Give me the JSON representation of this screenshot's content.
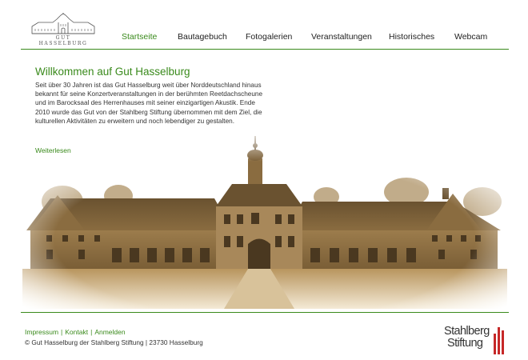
{
  "header": {
    "logo_text": "GUT HASSELBURG"
  },
  "nav": {
    "items": [
      {
        "label": "Startseite",
        "active": true
      },
      {
        "label": "Bautagebuch",
        "active": false
      },
      {
        "label": "Fotogalerien",
        "active": false
      },
      {
        "label": "Veranstaltungen",
        "active": false
      },
      {
        "label": "Historisches",
        "active": false
      },
      {
        "label": "Webcam",
        "active": false
      }
    ]
  },
  "main": {
    "title": "Willkommen auf Gut Hasselburg",
    "text": "Seit über 30 Jahren ist das Gut Hasselburg weit über Norddeutschland hinaus bekannt für seine Konzertveranstaltungen in der berühmten Reetdachscheune und im Barocksaal des Herrenhauses mit seiner einzigartigen Akustik. Ende 2010 wurde das Gut von der Stahlberg Stiftung übernommen mit dem Ziel, die kulturellen Aktivitäten zu erweitern und noch lebendiger zu gestalten.",
    "readmore": "Weiterlesen"
  },
  "footer": {
    "links": [
      "Impressum",
      "Kontakt",
      "Anmelden"
    ],
    "copyright": "© Gut Hasselburg der Stahlberg Stiftung | 23730 Hasselburg"
  },
  "sponsor": {
    "line1": "Stahlberg",
    "line2": "Stiftung"
  },
  "colors": {
    "accent": "#3a8a1c",
    "sponsor_red": "#c62828",
    "photo_sepia": "#8a6a3a"
  }
}
